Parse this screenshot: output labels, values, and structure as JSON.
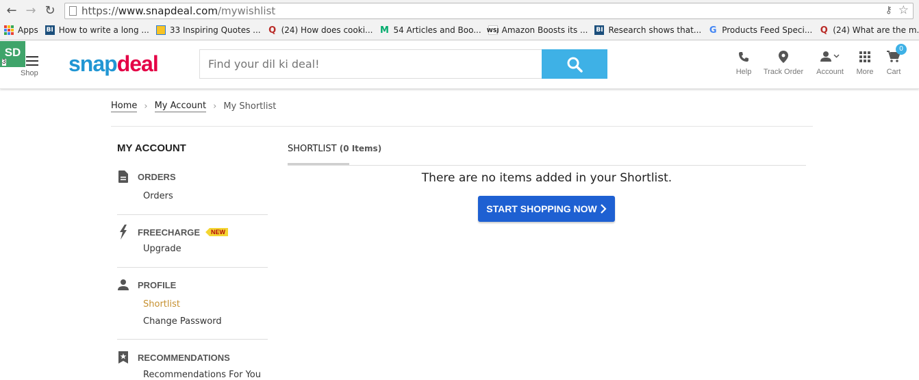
{
  "browser": {
    "url_scheme": "https://",
    "url_host": "www.snapdeal.com",
    "url_path": "/mywishlist",
    "bookmarks": [
      {
        "label": "Apps",
        "icon": "apps-grid-icon"
      },
      {
        "label": "How to write a long ...",
        "icon": "bi-icon"
      },
      {
        "label": "33 Inspiring Quotes ...",
        "icon": "quotes-icon"
      },
      {
        "label": "(24) How does cooki...",
        "icon": "quora-icon"
      },
      {
        "label": "54 Articles and Boo...",
        "icon": "medium-icon"
      },
      {
        "label": "Amazon Boosts its ...",
        "icon": "wsj-icon"
      },
      {
        "label": "Research shows that...",
        "icon": "bi-icon"
      },
      {
        "label": "Products Feed Speci...",
        "icon": "google-icon"
      },
      {
        "label": "(24) What are the m...",
        "icon": "quora-icon"
      }
    ]
  },
  "header": {
    "badge": "SD",
    "badge_count": "3",
    "shop_label": "Shop",
    "logo_snap": "snap",
    "logo_deal": "deal",
    "search_placeholder": "Find your dil ki deal!",
    "nav": [
      {
        "label": "Help",
        "icon": "phone-icon"
      },
      {
        "label": "Track Order",
        "icon": "location-pin-icon"
      },
      {
        "label": "Account",
        "icon": "user-icon"
      },
      {
        "label": "More",
        "icon": "grid-icon"
      },
      {
        "label": "Cart",
        "icon": "cart-icon"
      }
    ],
    "cart_count": "0"
  },
  "breadcrumb": {
    "home": "Home",
    "account": "My Account",
    "current": "My Shortlist"
  },
  "sidebar": {
    "title": "MY ACCOUNT",
    "sections": [
      {
        "title": "ORDERS",
        "icon": "document-icon",
        "links": [
          "Orders"
        ]
      },
      {
        "title": "FREECHARGE",
        "icon": "freecharge-icon",
        "tag": "NEW",
        "links": [
          "Upgrade"
        ]
      },
      {
        "title": "PROFILE",
        "icon": "person-icon",
        "links": [
          "Shortlist",
          "Change Password"
        ]
      },
      {
        "title": "RECOMMENDATIONS",
        "icon": "star-bookmark-icon",
        "links": [
          "Recommendations For You"
        ]
      }
    ]
  },
  "main": {
    "tab_label": "SHORTLIST",
    "tab_count": "(0 Items)",
    "empty_message": "There are no items added in your Shortlist.",
    "cta_label": "START SHOPPING NOW"
  },
  "colors": {
    "snap_blue": "#2196d3",
    "deal_red": "#e40046",
    "search_button": "#3eb1e6",
    "cta_blue": "#1e60d2",
    "active_link": "#c6902f",
    "sd_badge": "#3fa46a"
  }
}
